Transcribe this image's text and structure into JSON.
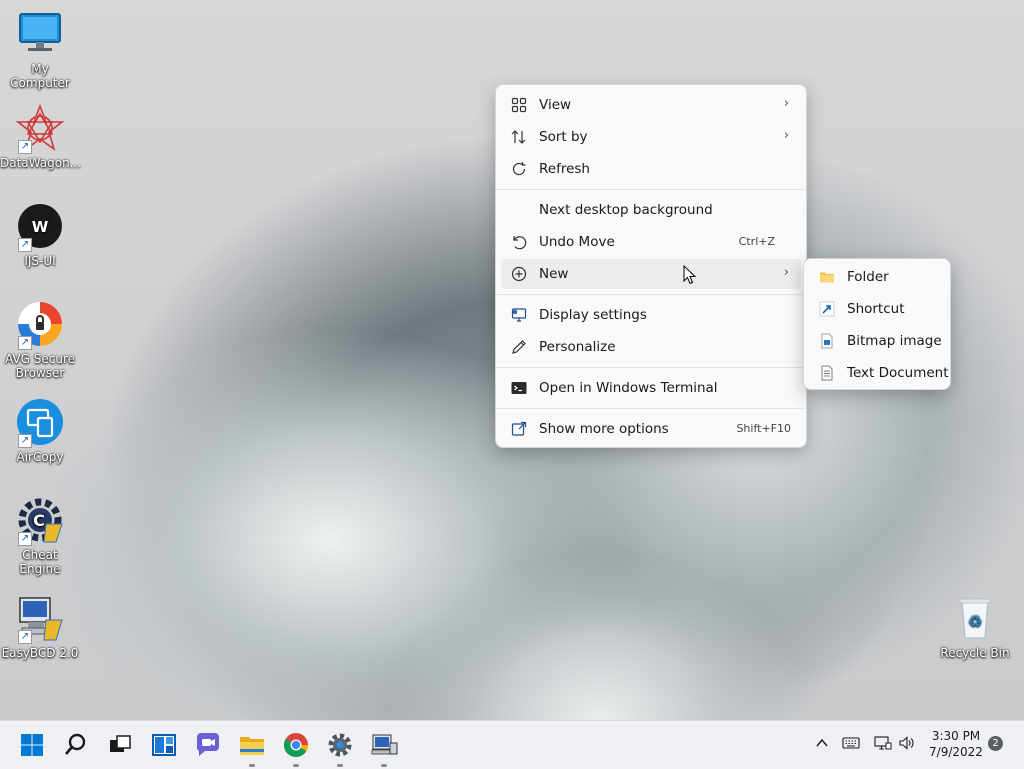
{
  "desktop_icons": [
    {
      "label": "My Computer"
    },
    {
      "label": "DataWagon..."
    },
    {
      "label": "IJS-UI"
    },
    {
      "label": "AVG Secure Browser"
    },
    {
      "label": "AirCopy"
    },
    {
      "label": "Cheat Engine"
    },
    {
      "label": "EasyBCD 2.0"
    },
    {
      "label": "Recycle Bin"
    }
  ],
  "context_menu": {
    "items": [
      {
        "label": "View",
        "icon": "grid-icon"
      },
      {
        "label": "Sort by",
        "icon": "sort-icon"
      },
      {
        "label": "Refresh",
        "icon": "refresh-icon"
      },
      {
        "label": "Next desktop background"
      },
      {
        "label": "Undo Move",
        "shortcut": "Ctrl+Z",
        "icon": "undo-icon"
      },
      {
        "label": "New",
        "icon": "plus-circle-icon"
      },
      {
        "label": "Display settings",
        "icon": "display-icon"
      },
      {
        "label": "Personalize",
        "icon": "pen-icon"
      },
      {
        "label": "Open in Windows Terminal",
        "icon": "terminal-icon"
      },
      {
        "label": "Show more options",
        "shortcut": "Shift+F10",
        "icon": "share-icon"
      }
    ]
  },
  "submenu": {
    "items": [
      {
        "label": "Folder",
        "icon": "folder-icon"
      },
      {
        "label": "Shortcut",
        "icon": "shortcut-icon"
      },
      {
        "label": "Bitmap image",
        "icon": "bitmap-icon"
      },
      {
        "label": "Text Document",
        "icon": "text-document-icon"
      }
    ]
  },
  "taskbar": {
    "apps": [
      "start",
      "search",
      "task-view",
      "widgets",
      "chat",
      "file-explorer",
      "chrome",
      "settings",
      "network-tool"
    ],
    "clock": {
      "time": "3:30 PM",
      "date": "7/9/2022"
    },
    "notifications": "2"
  },
  "colors": {
    "accent": "#0067c0",
    "menu_bg": "#f9f9f9",
    "taskbar_bg": "#eef0f3"
  }
}
